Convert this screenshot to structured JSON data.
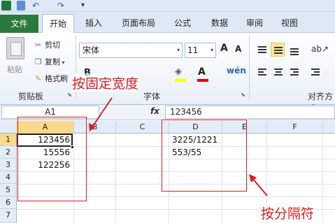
{
  "quick_access": {
    "undo_icon": "↶",
    "redo_icon": "↷",
    "more_icon": "▾"
  },
  "tabs": {
    "file": "文件",
    "home": "开始",
    "insert": "插入",
    "page_layout": "页面布局",
    "formulas": "公式",
    "data": "数据",
    "review": "审阅",
    "view": "视图"
  },
  "clipboard": {
    "paste": "粘贴",
    "cut": "剪切",
    "copy": "复制",
    "format_painter": "格式刷",
    "group_label": "剪贴板"
  },
  "font": {
    "name": "宋体",
    "size": "11",
    "bold": "B",
    "grow": "A",
    "shrink": "A",
    "font_color": "A",
    "phonetic": "wén",
    "group_label": "字体",
    "fill_color": "#ffff00",
    "font_color_value": "#e00000"
  },
  "alignment": {
    "group_label": "对齐方式"
  },
  "formula_bar": {
    "name_box": "A1",
    "fx": "fx",
    "value": "123456"
  },
  "columns": [
    "A",
    "B",
    "C",
    "D",
    "E",
    "F"
  ],
  "rows": [
    "1",
    "2",
    "3",
    "4",
    "5",
    "6",
    "7"
  ],
  "cells": {
    "A1": "123456",
    "A2": "15556",
    "A3": "122256",
    "D1": "3225/1221",
    "D2": "553/55"
  },
  "annotations": {
    "fixed_width": "按固定宽度",
    "delimiter": "按分隔符",
    "color": "#d42020"
  },
  "colors": {
    "accent_file_tab": "#2b7a3d",
    "selected_header": "#fcd88a"
  }
}
